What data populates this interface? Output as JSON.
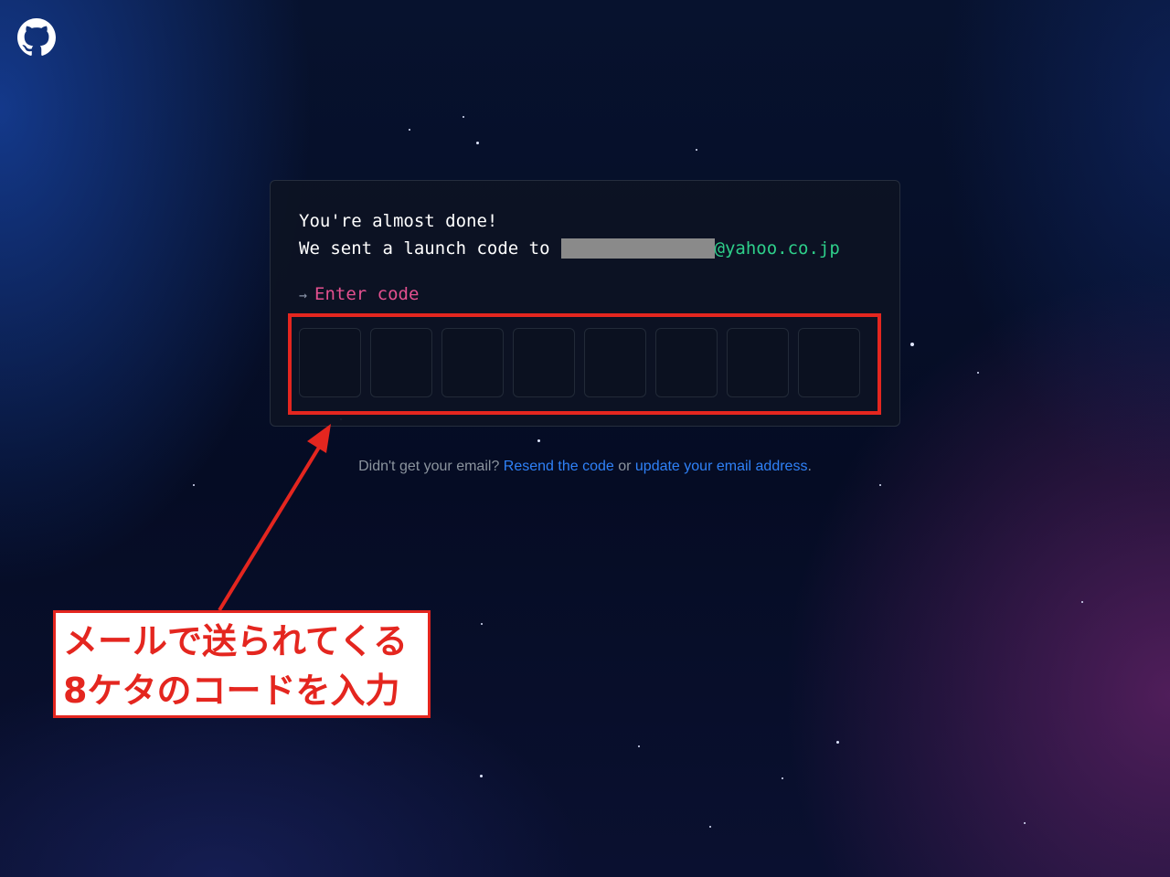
{
  "header": {
    "logo_icon": "github-octocat-icon"
  },
  "card": {
    "line1": "You're almost done!",
    "line2_prefix": "We sent a launch code to",
    "email_domain": "@yahoo.co.jp",
    "prompt_arrow": "→",
    "prompt_label": "Enter code",
    "code_digits": 8
  },
  "footer": {
    "text_before": "Didn't get your email? ",
    "resend_link": "Resend the code",
    "middle_text": " or ",
    "update_link": "update your email address",
    "text_after": "."
  },
  "annotation": {
    "line1": "メールで送られてくる",
    "line2": "8ケタのコードを入力"
  },
  "colors": {
    "accent_pink": "#e4508f",
    "email_green": "#2ecf8a",
    "link_blue": "#2f81f7",
    "annotation_red": "#e4261f"
  }
}
